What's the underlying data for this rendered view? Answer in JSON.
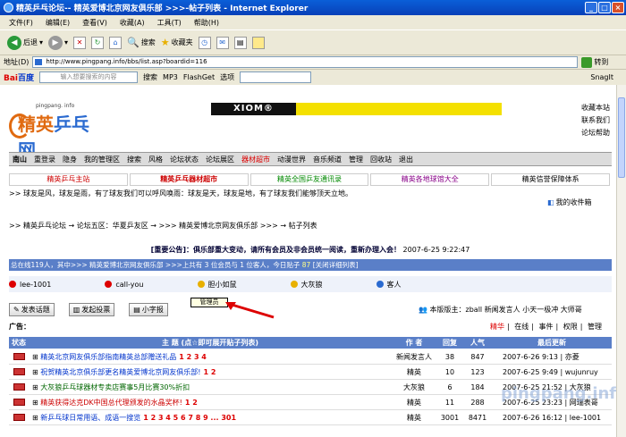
{
  "window": {
    "title": "精英乒乓论坛-- 精英爱博北京网友俱乐部 >>>-帖子列表 - Internet Explorer"
  },
  "menu": [
    "文件(F)",
    "编辑(E)",
    "查看(V)",
    "收藏(A)",
    "工具(T)",
    "帮助(H)"
  ],
  "toolbar": {
    "back": "后退",
    "search": "搜索",
    "favorites": "收藏夹"
  },
  "address": {
    "label": "地址(D)",
    "url": "http://www.pingpang.info/bbs/list.asp?boardid=116",
    "go": "转到"
  },
  "baidubar": {
    "logo": "Bai",
    "logo2": "百度",
    "placeholder": "输入想要搜索的内容",
    "search": "搜索",
    "mp3": "MP3",
    "flashget": "FlashGet",
    "options": "选项",
    "snagit": "SnagIt"
  },
  "logo": {
    "small": "pingpang. info",
    "big1": "精英",
    "big2": "乒乓网"
  },
  "banner": {
    "text": "XIOM®"
  },
  "right_links": [
    "收藏本站",
    "联系我们",
    "论坛帮助"
  ],
  "nav": [
    "南山",
    "重登录",
    "隐身",
    "我的管理区",
    "搜索",
    "风格",
    "论坛状态",
    "论坛展区",
    "器材超市",
    "动漫世界",
    "音乐频道",
    "管理",
    "回收站",
    "退出"
  ],
  "subnav": [
    "精英乒乓主站",
    "精英乒乓器材超市",
    "精英全国乒友通讯录",
    "精英各地球馆大全",
    "精英信誉保障体系"
  ],
  "slogan": ">> 球友是风，球友是雨，有了球友我们可以呼风唤雨：球友是天，球友是地，有了球友我们能够顶天立地。",
  "fav": "我的收件箱",
  "breadcrumb": ">> 精英乒乓论坛 → 论坛五区：华夏乒友区 → >>> 精英爱博北京网友俱乐部 >>> → 帖子列表",
  "notice": {
    "text": "[重要公告]：俱乐部重大变动，请所有会员及非会员统一阅读，重新办理入会！",
    "time": "2007-6-25 9:22:47"
  },
  "stats": {
    "text": "总在线119人，其中>>> 精英爱博北京网友俱乐部 >>>上共有 3 位会员与 1 位客人，今日贴子",
    "today": "87",
    "link": "[关闭详细列表]"
  },
  "legend": [
    "lee-1001",
    "call-you",
    "胆小如鼠",
    "大灰狼",
    "客人"
  ],
  "buttons": [
    "发表话题",
    "发起投票",
    "小字报"
  ],
  "tooltip": "管理员",
  "moderators": "本版版主：zball 新闻发言人 小天一极冲 大师哥",
  "guangao": "广告：",
  "ops": [
    "精华",
    "在线",
    "事件",
    "权限",
    "管理"
  ],
  "table": {
    "headers": [
      "状态",
      "主 题 (点☆即可展开贴子列表)",
      "作 者",
      "回复",
      "人气",
      "最后更新"
    ],
    "rows": [
      {
        "title": "精英北京网友俱乐部指南精英总部赠送礼品",
        "pages": "1 2 3 4",
        "author": "新闻发言人",
        "replies": "38",
        "views": "847",
        "last": "2007-6-26 9:13 | 亦菱",
        "style": "t"
      },
      {
        "title": "祝贺精英北京俱乐部更名精英爱博北京网友俱乐部!",
        "pages": "1 2",
        "author": "精英",
        "replies": "10",
        "views": "123",
        "last": "2007-6-25 9:49 | wujunruy",
        "style": "t"
      },
      {
        "title": "大灰狼乒乓球器材专卖店赛事5月比赛30%折扣",
        "pages": "",
        "author": "大灰狼",
        "replies": "6",
        "views": "184",
        "last": "2007-6-25 21:52 | 大灰狼",
        "style": "green"
      },
      {
        "title": "精英获得达克DK中国总代理颁发的水晶奖杯!",
        "pages": "1 2",
        "author": "精英",
        "replies": "11",
        "views": "288",
        "last": "2007-6-25 23:23 | 网瑞表哥",
        "style": "red"
      },
      {
        "title": "新乒乓球日常用语、成语一搜览",
        "pages": "1 2 3 4 5 6 7 8 9 ... 301",
        "author": "精英",
        "replies": "3001",
        "views": "8471",
        "last": "2007-6-26 16:12 | lee-1001",
        "style": "t"
      }
    ]
  },
  "watermark": "pingpang.info",
  "colors": {
    "accent": "#5a7fc8",
    "highlight": "#d00000"
  }
}
